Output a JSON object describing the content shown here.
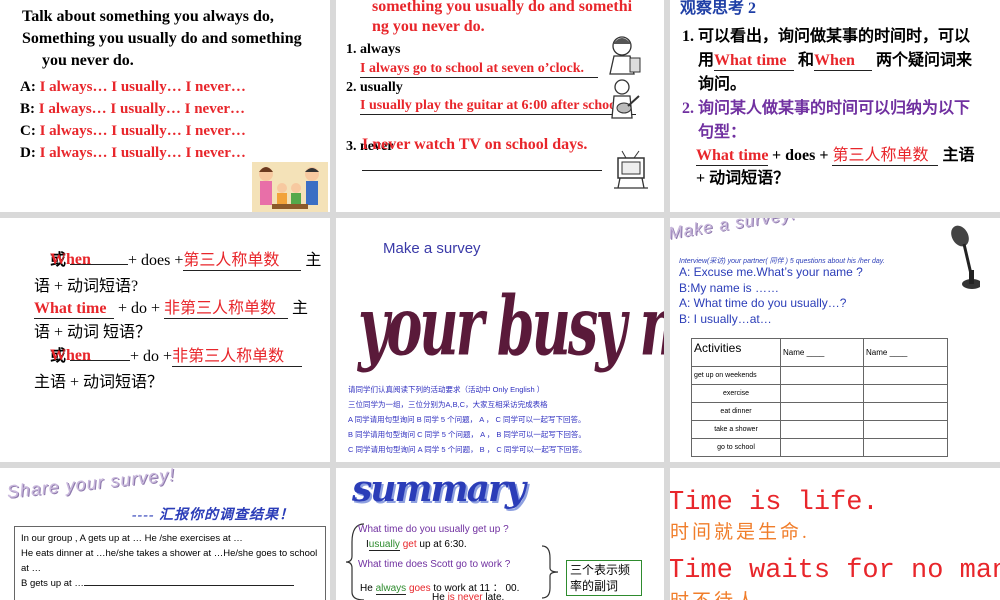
{
  "s1": {
    "title_line1": "Talk about something you always do,",
    "title_line2": "Something you usually do and something",
    "title_line3": "you never do.",
    "rows": [
      {
        "letter": "A:",
        "text": "I always… I usually… I never…"
      },
      {
        "letter": "B:",
        "text": "I always… I usually… I never…"
      },
      {
        "letter": "C:",
        "text": "I always… I usually… I never…"
      },
      {
        "letter": "D:",
        "text": "I always… I usually… I never…"
      }
    ]
  },
  "s2": {
    "heading_line1": "something you usually do and somethi",
    "heading_line2": "ng you never do.",
    "item1_label": "1. always",
    "item1_answer": "I always go to school at seven o’clock.",
    "item2_label": "2. usually",
    "item2_answer": "I usually play the guitar at 6:00 after school.",
    "item3_label": "3. never",
    "item3_answer": "I never watch TV on school days."
  },
  "s3": {
    "heading": "观察思考 2",
    "p1_line1": "1.  可以看出，询问做某事的时间时，可以",
    "p1_use": "用",
    "blank_what_time": "What time",
    "p1_and": "和",
    "blank_when": "When",
    "p1_tail": "两个疑问词来",
    "p1_line3": "询问。",
    "p2_line1": "2.  询问某人做某事的时间可以归纳为以下",
    "p2_line2": "句型：",
    "pattern_blank1": "What time",
    "pattern_plus_does": "+ does +",
    "pattern_blank2": "第三人称单数",
    "pattern_subject": "主语",
    "pattern_line2": "+  动词短语？"
  },
  "s4": {
    "or1": "或",
    "blank_when1": "When",
    "plus_does": "+ does +",
    "blank_third1": "第三人称单数",
    "subj1": "主",
    "line2": "语 + 动词短语?",
    "blank_what_time": "What time",
    "plus_do": "+ do +",
    "blank_nonthird": "非第三人称单数",
    "subj2": "主",
    "line4": "语  +  动词  短语？",
    "or2": "或",
    "blank_when2": "When",
    "plus_do2": "+  do +",
    "blank_third2": "非第三人称单数",
    "line6": "主语 + 动词短语？"
  },
  "s5": {
    "title": "Make a survey",
    "big_text": "your busy morning",
    "instructions": [
      "请同学们认真阅读下列的活动要求（活动中 Only English ）",
      "三位同学为一组，三位分别为A,B,C，大家互相采访完成表格",
      "A 同学请用句型询问 B  同学 5 个问题，  A ，  C 同学可以一起写下回答。",
      "B 同学请用句型询问 C  同学 5 个问题，  A ，  B 同学可以一起写下回答。",
      "C 同学请用句型询问 A  同学 5 个问题，  B ，  C 同学可以一起写下回答。"
    ]
  },
  "s6": {
    "title": "Make a survey!",
    "subtitle": "Interview(采访)  your partner( 同伴 ) 5 questions about his /her day.",
    "dialog": [
      "A: Excuse me.What’s your name ?",
      "B:My name is ……",
      "A: What time do you usually…?",
      "B: I usually…at…"
    ],
    "table_header": [
      "Activities",
      "Name ____",
      "Name ____"
    ],
    "table_rows": [
      "get up on weekends",
      "exercise",
      "eat dinner",
      "take a shower",
      "go to school"
    ]
  },
  "s7": {
    "title": "Share your survey!",
    "subtitle": "---- 汇报你的调查结果！",
    "lines": [
      "In  our group ,  A gets up at  …  He /she exercises at …",
      "He eats dinner at …he/she takes a shower at  …He/she goes to school at …",
      "B gets up at …"
    ]
  },
  "s8": {
    "title": "summary",
    "q1": "What time do you usually get up ?",
    "a1_pre": "I",
    "a1_adv": "usually",
    "a1_verb": "get",
    "a1_post": "up at 6:30.",
    "q2": "What time does Scott go to work ?",
    "a2_pre": "He",
    "a2_adv": "always",
    "a2_verb": "goes",
    "a2_post": "to work at 11 ： 00.",
    "a3_pre": "He",
    "a3_verb": "is",
    "a3_adv": "never",
    "a3_post": "late.",
    "box_text": "三个表示频率的副词"
  },
  "s9": {
    "line1": "Time is life.",
    "line2": "时间就是生命.",
    "line3": "Time waits for no man",
    "line4": "时不待人"
  },
  "colors": {
    "red": "#e8262b",
    "purple": "#7030a0",
    "blue": "#1f3fa6",
    "orange": "#f07d2a"
  }
}
